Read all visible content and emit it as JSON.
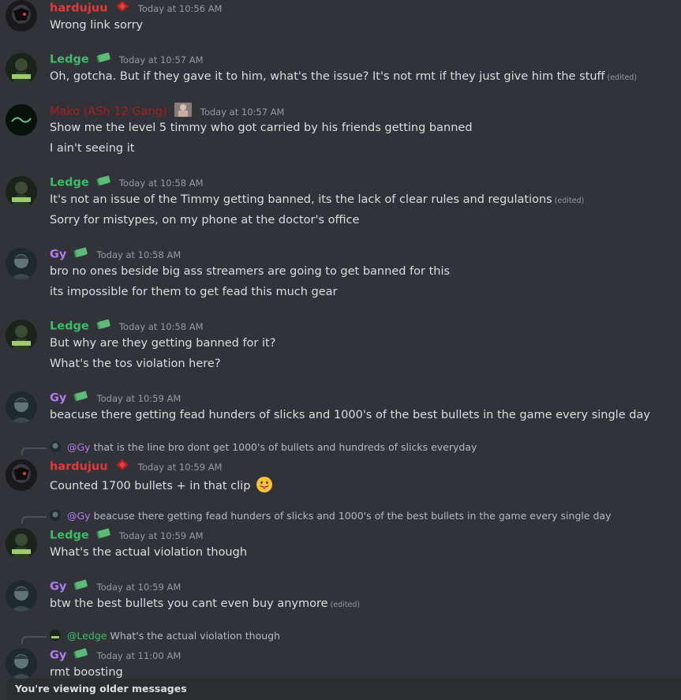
{
  "colors": {
    "background": "#323339",
    "hardujuu": "#e23a3a",
    "ledge": "#3bbd6a",
    "mako": "#a61f1f",
    "gy": "#b07cf3",
    "timestamp": "#949ba4",
    "text": "#dbdee1",
    "older_bar": "#2b2d31"
  },
  "messages": [
    {
      "author": "hardujuu",
      "timestamp": "Today at 10:56 AM",
      "lines": [
        "Wrong link sorry"
      ]
    },
    {
      "author": "Ledge",
      "timestamp": "Today at 10:57 AM",
      "lines": [
        "Oh, gotcha. But if they gave it to him, what's the issue? It's not rmt if they just give him the stuff"
      ],
      "edited": "(edited)"
    },
    {
      "author": "Mako (ASh 12 Gang)",
      "timestamp": "Today at 10:57 AM",
      "lines": [
        "Show me the level 5 timmy who got carried by his friends getting banned",
        "I ain't seeing it"
      ]
    },
    {
      "author": "Ledge",
      "timestamp": "Today at 10:58 AM",
      "lines": [
        "It's not an issue of the Timmy getting banned, its the lack of clear rules and regulations",
        "Sorry for mistypes, on my phone at the doctor's office"
      ],
      "edited": "(edited)"
    },
    {
      "author": "Gy",
      "timestamp": "Today at 10:58 AM",
      "lines": [
        "bro no ones beside big ass streamers are going to get banned for this",
        "its impossible for them to get fead this much gear"
      ]
    },
    {
      "author": "Ledge",
      "timestamp": "Today at 10:58 AM",
      "lines": [
        "But why are they getting banned for it?",
        "What's the tos violation here?"
      ]
    },
    {
      "author": "Gy",
      "timestamp": "Today at 10:59 AM",
      "lines": [
        "beacuse there getting fead hunders of slicks and 1000's of the best bullets in the game every single day"
      ]
    },
    {
      "author": "hardujuu",
      "timestamp": "Today at 10:59 AM",
      "reply_mention": "@Gy",
      "reply_text": "that is the line bro dont get 1000's of bullets and hundreds of slicks everyday",
      "lines": [
        "Counted 1700 bullets + in that clip"
      ],
      "emoji": "tongue-out-emoji"
    },
    {
      "author": "Ledge",
      "timestamp": "Today at 10:59 AM",
      "reply_mention": "@Gy",
      "reply_text": "beacuse there getting fead hunders of slicks and 1000's of the best bullets in the game every single day",
      "lines": [
        "What's the actual violation though"
      ]
    },
    {
      "author": "Gy",
      "timestamp": "Today at 10:59 AM",
      "lines": [
        "btw the best bullets you cant even buy anymore"
      ],
      "edited": "(edited)"
    },
    {
      "author": "Gy",
      "timestamp": "Today at 11:00 AM",
      "reply_mention": "@Ledge",
      "reply_text": "What's the actual violation though",
      "lines": [
        "rmt boosting"
      ]
    }
  ],
  "older_messages_bar": "You're viewing older messages"
}
